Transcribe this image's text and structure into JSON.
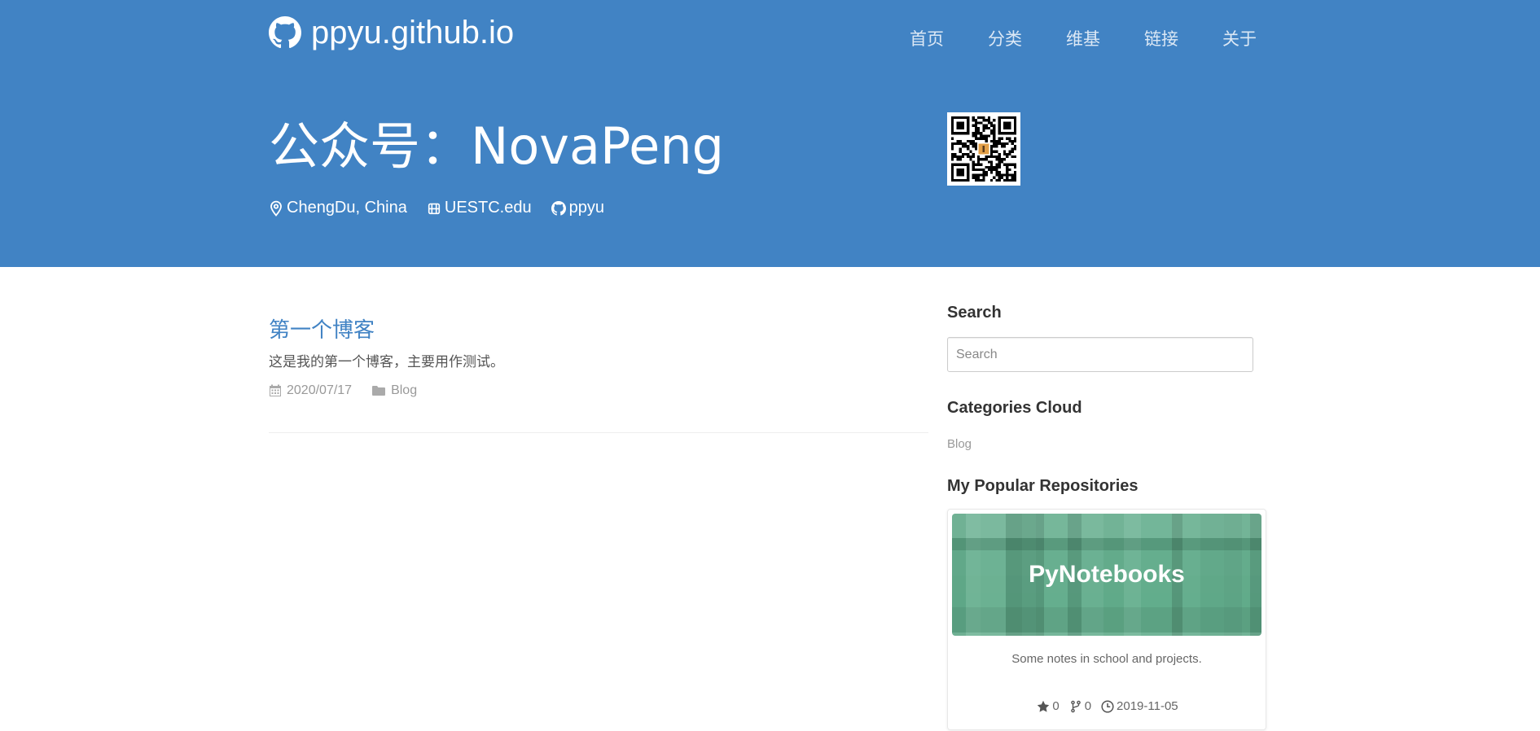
{
  "header": {
    "brand_title": "ppyu.github.io",
    "nav": [
      "首页",
      "分类",
      "维基",
      "链接",
      "关于"
    ],
    "heading": "公众号：NovaPeng",
    "meta": {
      "location": "ChengDu, China",
      "organization": "UESTC.edu",
      "github": "ppyu"
    },
    "color": "#4183c4"
  },
  "posts": [
    {
      "title": "第一个博客",
      "excerpt": "这是我的第一个博客，主要用作测试。",
      "date": "2020/07/17",
      "category": "Blog"
    }
  ],
  "sidebar": {
    "search": {
      "heading": "Search",
      "placeholder": "Search"
    },
    "categories": {
      "heading": "Categories Cloud",
      "items": [
        "Blog"
      ]
    },
    "repos": {
      "heading": "My Popular Repositories",
      "items": [
        {
          "name": "PyNotebooks",
          "description": "Some notes in school and projects.",
          "stars": "0",
          "forks": "0",
          "updated": "2019-11-05",
          "banner_color": "#62ad8c"
        }
      ]
    }
  },
  "icons": {
    "brand": "github-icon",
    "location": "map-marker-icon",
    "organization": "organization-icon",
    "github": "github-icon",
    "date": "calendar-icon",
    "category": "folder-icon",
    "stars": "star-icon",
    "forks": "fork-icon",
    "updated": "clock-icon"
  }
}
